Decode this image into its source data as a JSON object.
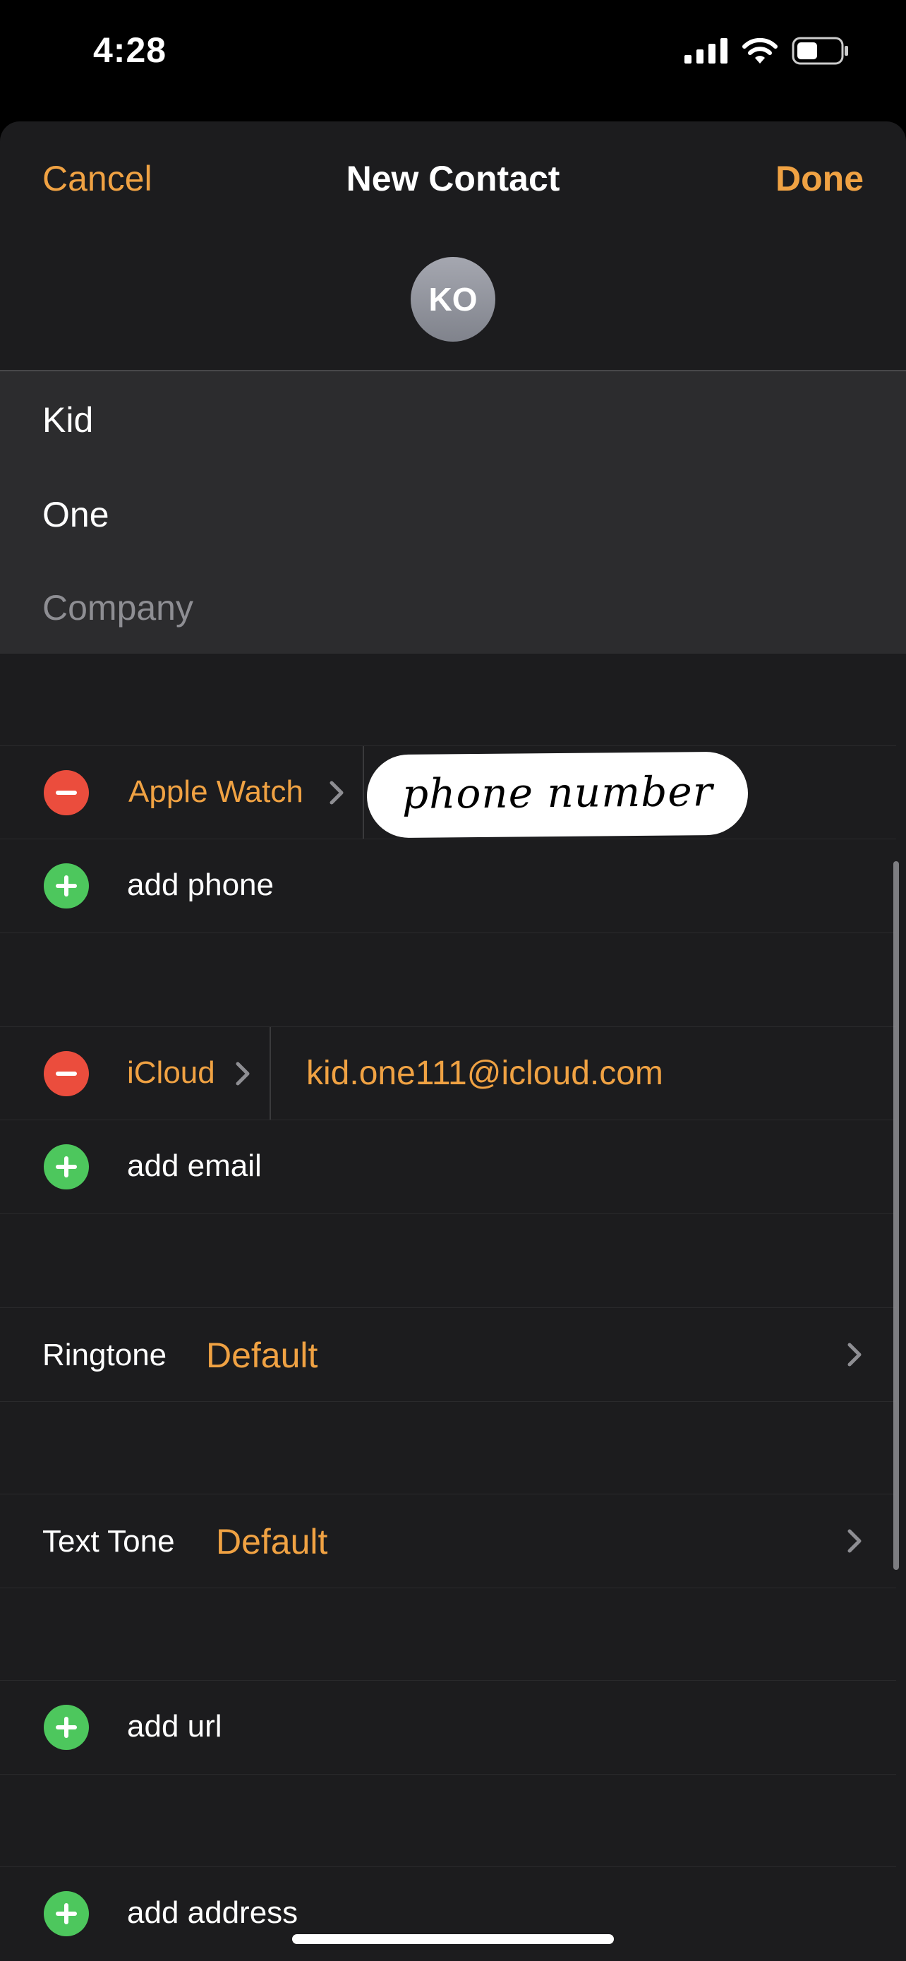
{
  "status_bar": {
    "time": "4:28"
  },
  "nav": {
    "cancel": "Cancel",
    "title": "New Contact",
    "done": "Done"
  },
  "avatar": {
    "initials": "KO"
  },
  "name_fields": {
    "first": "Kid",
    "last": "One",
    "company_placeholder": "Company"
  },
  "phone": {
    "label": "Apple Watch",
    "redaction_text": "phone number",
    "add": "add phone"
  },
  "email": {
    "label": "iCloud",
    "value": "kid.one111@icloud.com",
    "add": "add email"
  },
  "ringtone": {
    "label": "Ringtone",
    "value": "Default"
  },
  "text_tone": {
    "label": "Text Tone",
    "value": "Default"
  },
  "url": {
    "add": "add url"
  },
  "address": {
    "add": "add address"
  },
  "colors": {
    "accent": "#f0a243",
    "remove": "#eb4d3d",
    "add": "#4dc75d",
    "sheet": "#1c1c1e",
    "name_block": "#2c2c2e"
  }
}
